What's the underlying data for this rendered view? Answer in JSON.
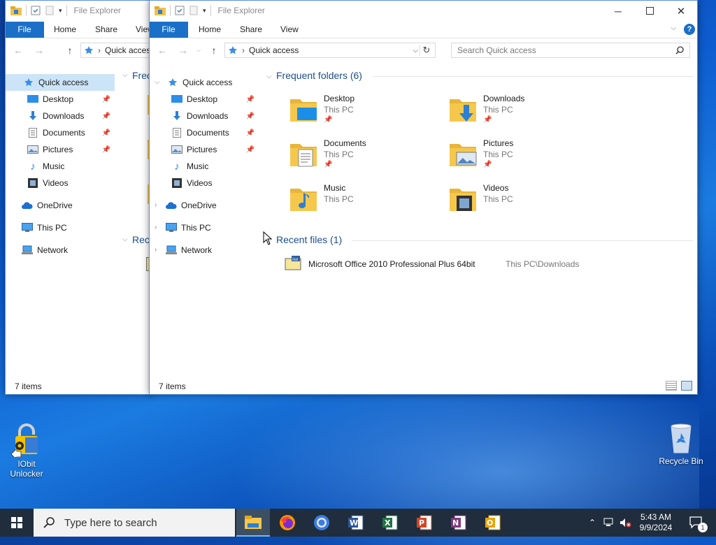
{
  "app": {
    "title": "File Explorer"
  },
  "ribbon": {
    "tabs": [
      "File",
      "Home",
      "Share",
      "View"
    ]
  },
  "back_window": {
    "address": "Quick access",
    "frequent_folders_label": "Frec",
    "recent_files_label": "Rec",
    "status": "7 items"
  },
  "address": {
    "path": "Quick access"
  },
  "search": {
    "placeholder": "Search Quick access"
  },
  "nav": {
    "quick_access": "Quick access",
    "items": [
      {
        "label": "Desktop",
        "pinned": true
      },
      {
        "label": "Downloads",
        "pinned": true
      },
      {
        "label": "Documents",
        "pinned": true
      },
      {
        "label": "Pictures",
        "pinned": true
      },
      {
        "label": "Music",
        "pinned": false
      },
      {
        "label": "Videos",
        "pinned": false
      }
    ],
    "onedrive": "OneDrive",
    "this_pc": "This PC",
    "network": "Network"
  },
  "frequent": {
    "header": "Frequent folders (6)",
    "folders": [
      {
        "name": "Desktop",
        "location": "This PC"
      },
      {
        "name": "Downloads",
        "location": "This PC"
      },
      {
        "name": "Documents",
        "location": "This PC"
      },
      {
        "name": "Pictures",
        "location": "This PC"
      },
      {
        "name": "Music",
        "location": "This PC"
      },
      {
        "name": "Videos",
        "location": "This PC"
      }
    ]
  },
  "recent": {
    "header": "Recent files (1)",
    "files": [
      {
        "name": "Microsoft Office 2010 Professional Plus 64bit",
        "path": "This PC\\Downloads",
        "badge": "iso"
      }
    ]
  },
  "status": {
    "items": "7 items"
  },
  "taskbar": {
    "search_placeholder": "Type here to search",
    "time": "5:43 AM",
    "date": "9/9/2024",
    "notifications": "1"
  },
  "desktop": {
    "iobit_label_1": "IObit",
    "iobit_label_2": "Unlocker",
    "recycle_bin": "Recycle Bin"
  },
  "colors": {
    "accent": "#1a6fc7",
    "folder_yellow": "#f5c84c",
    "taskbar": "#1f2d3d",
    "section_header": "#1e4e8c"
  }
}
